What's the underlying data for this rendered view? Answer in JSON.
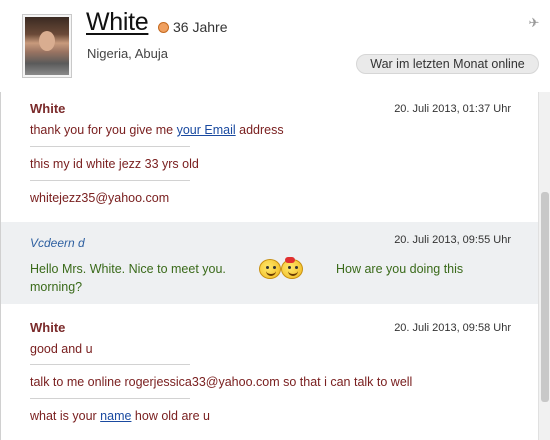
{
  "profile": {
    "name": "White",
    "age": "36 Jahre",
    "location": "Nigeria, Abuja",
    "online_status": "War im letzten Monat online"
  },
  "messages": [
    {
      "sender": "White",
      "time": "20. Juli 2013, 01:37 Uhr",
      "lines": [
        {
          "before": "thank you for you give me ",
          "link": "your Email",
          "after": " address"
        },
        {
          "text": "this my id white jezz 33 yrs old"
        },
        {
          "text": "whitejezz35@yahoo.com"
        }
      ]
    },
    {
      "sender": "Vcdeern d",
      "time": "20. Juli 2013, 09:55 Uhr",
      "text_part1": "Hello Mrs. White. Nice to meet you.",
      "text_part2": "How are you doing this",
      "text_part3": "morning?"
    },
    {
      "sender": "White",
      "time": "20. Juli 2013, 09:58 Uhr",
      "lines": [
        {
          "text": "good and u"
        },
        {
          "text": "talk to me online rogerjessica33@yahoo.com so that i can talk to well"
        },
        {
          "before": "what is your ",
          "link": "name",
          "after": " how old are u"
        }
      ]
    }
  ],
  "icons": {
    "age": "gender-icon",
    "pin": "pin-icon",
    "smiley": "smiley-couple-icon"
  }
}
